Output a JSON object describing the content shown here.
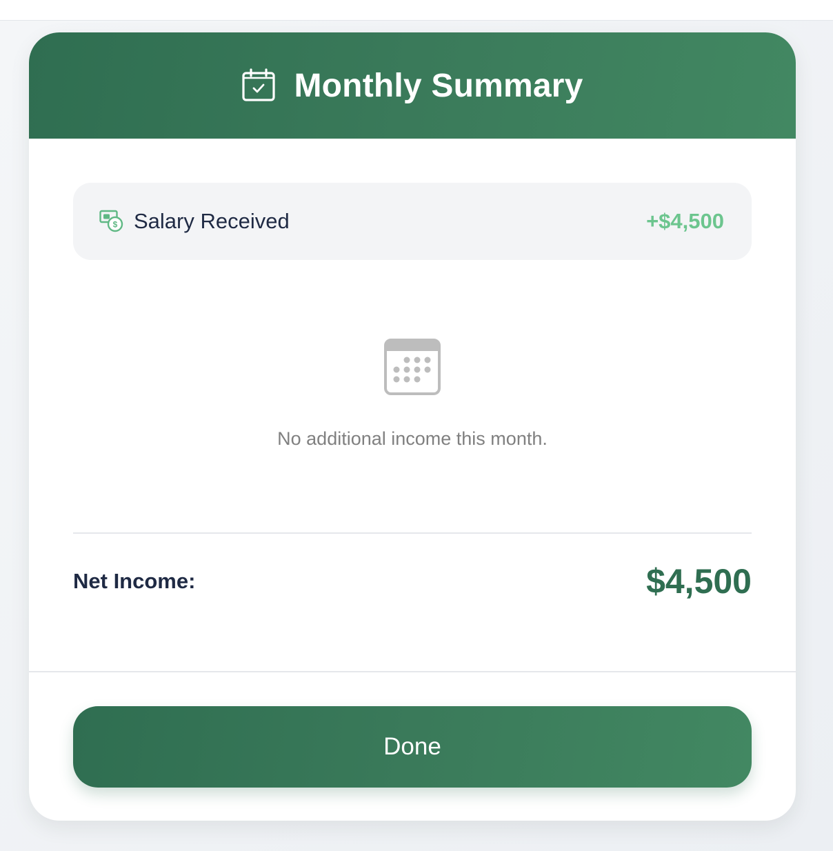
{
  "modal": {
    "title": "Monthly Summary",
    "header_icon": "calendar-check-icon"
  },
  "income": {
    "icon": "money-icon",
    "label": "Salary Received",
    "amount": "+$4,500"
  },
  "empty_state": {
    "icon": "calendar-grid-icon",
    "message": "No additional income this month."
  },
  "net": {
    "label": "Net Income:",
    "value": "$4,500"
  },
  "actions": {
    "done_label": "Done"
  },
  "colors": {
    "brand_green": "#2f6e51",
    "income_green": "#6cc58e",
    "text_dark": "#1f2a44",
    "text_muted": "#808080"
  }
}
